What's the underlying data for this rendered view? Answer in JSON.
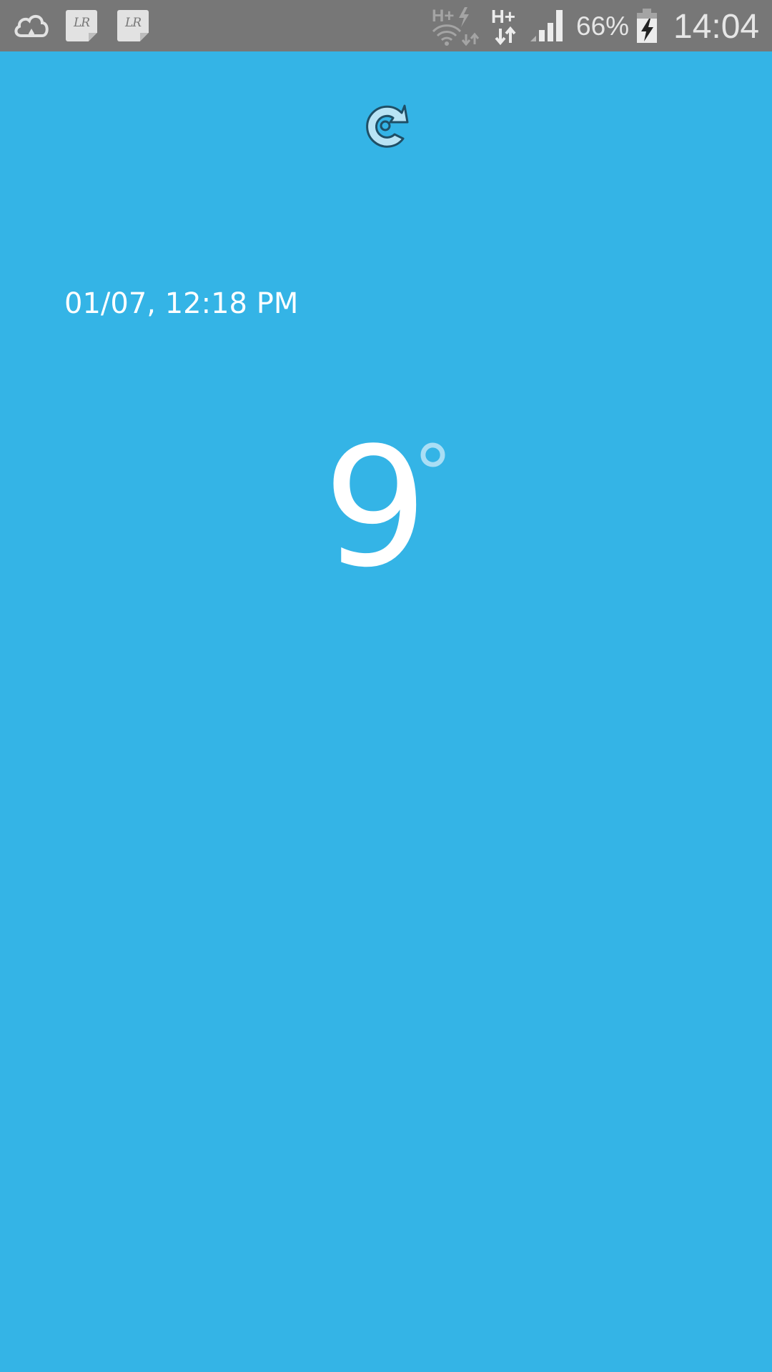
{
  "status_bar": {
    "icons": [
      "cloud-icon",
      "lr-notification-icon",
      "lr-notification-icon",
      "wifi-hplus-icon",
      "hplus-data-icon",
      "signal-icon",
      "battery-charging-icon"
    ],
    "lr_label": "LR",
    "battery_percent": "66%",
    "time": "14:04"
  },
  "weather": {
    "refresh_icon": "refresh-icon",
    "updated": "01/07, 12:18 PM",
    "temperature": "9",
    "degree_symbol": "°"
  },
  "colors": {
    "background": "#34b4e6",
    "status_bar": "#777777",
    "text": "#ffffff",
    "degree": "#a9def5"
  }
}
